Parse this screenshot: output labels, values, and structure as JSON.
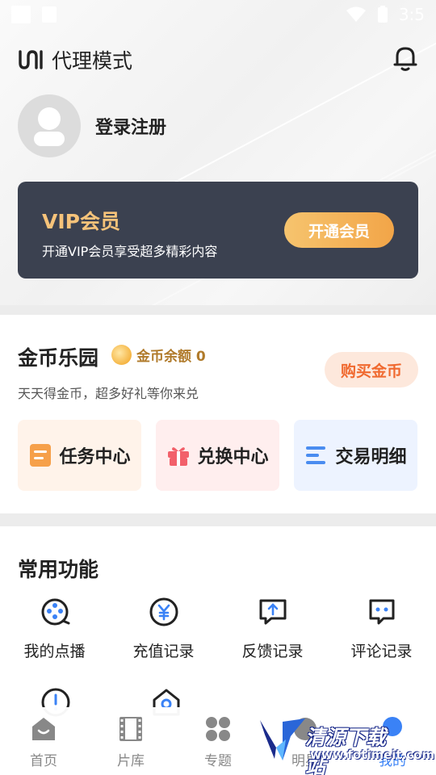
{
  "status_bar": {
    "time": "3:5"
  },
  "header": {
    "title": "代理模式"
  },
  "profile": {
    "login_label": "登录注册"
  },
  "vip": {
    "title": "VIP会员",
    "description": "开通VIP会员享受超多精彩内容",
    "button_label": "开通会员"
  },
  "coins": {
    "title": "金币乐园",
    "balance_label": "金币余额 0",
    "subtitle": "天天得金币，超多好礼等你来兑",
    "buy_label": "购买金币",
    "cards": [
      {
        "label": "任务中心",
        "icon": "task-icon"
      },
      {
        "label": "兑换中心",
        "icon": "gift-icon"
      },
      {
        "label": "交易明细",
        "icon": "list-icon"
      }
    ]
  },
  "functions": {
    "title": "常用功能",
    "items": [
      {
        "label": "我的点播",
        "icon": "film-reel-icon"
      },
      {
        "label": "充值记录",
        "icon": "yen-icon"
      },
      {
        "label": "反馈记录",
        "icon": "feedback-icon"
      },
      {
        "label": "评论记录",
        "icon": "comment-icon"
      }
    ],
    "row2_icons": [
      "alert-icon",
      "home-settings-icon"
    ]
  },
  "tabbar": {
    "items": [
      {
        "label": "首页",
        "icon": "home-icon"
      },
      {
        "label": "片库",
        "icon": "film-icon"
      },
      {
        "label": "专题",
        "icon": "grid-icon"
      },
      {
        "label": "明星",
        "icon": "star-icon"
      },
      {
        "label": "我的",
        "icon": "user-icon"
      }
    ]
  },
  "watermark": {
    "text": "清源下载站",
    "url": "www.fotimeit.com"
  },
  "colors": {
    "accent": "#3a82f6",
    "vip_gold": "#f6c37a",
    "coin_orange": "#f0692f"
  }
}
